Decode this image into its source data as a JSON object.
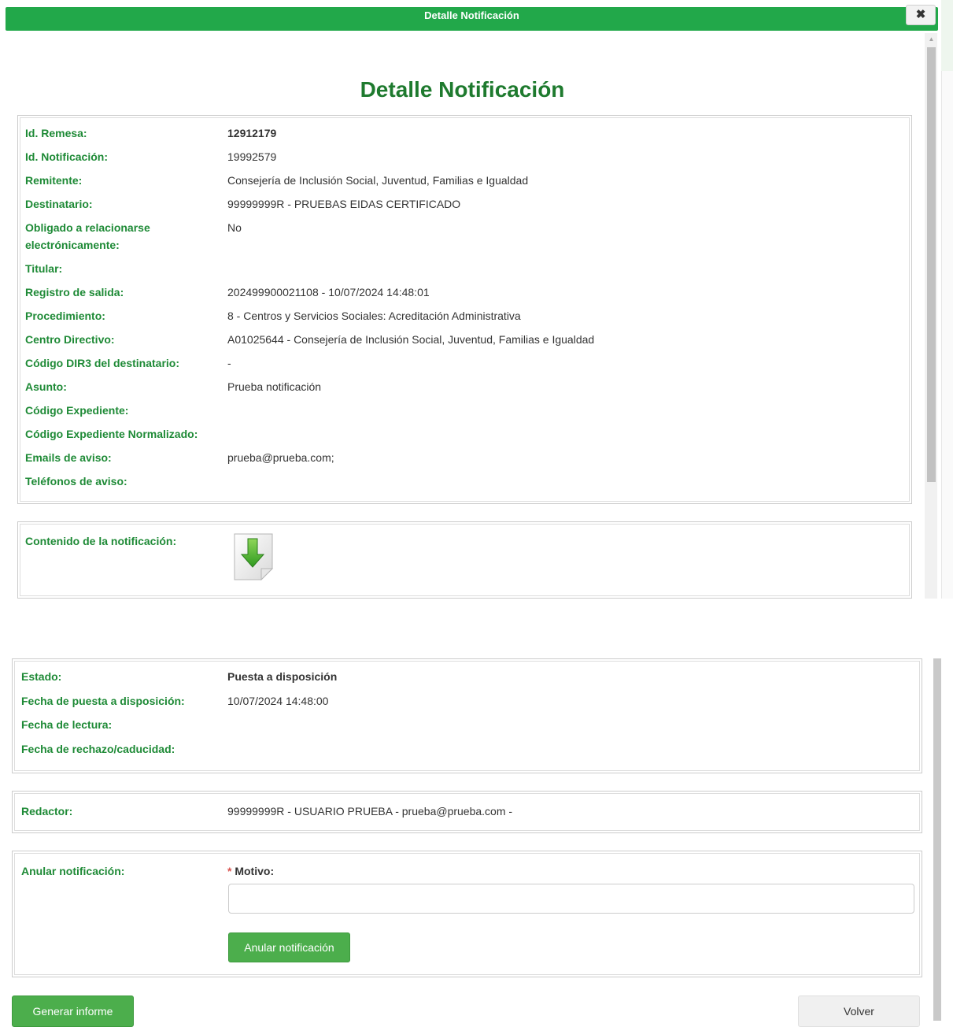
{
  "modal": {
    "title": "Detalle Notificación",
    "close_icon": "✖"
  },
  "heading": "Detalle Notificación",
  "details": {
    "id_remesa_label": "Id. Remesa:",
    "id_remesa_value": "12912179",
    "id_notificacion_label": "Id. Notificación:",
    "id_notificacion_value": "19992579",
    "remitente_label": "Remitente:",
    "remitente_value": "Consejería de Inclusión Social, Juventud, Familias e Igualdad",
    "destinatario_label": "Destinatario:",
    "destinatario_value": "99999999R - PRUEBAS EIDAS CERTIFICADO",
    "obligado_label_1": "Obligado a relacionarse",
    "obligado_label_2": "electrónicamente:",
    "obligado_value": "No",
    "titular_label": "Titular:",
    "registro_label": "Registro de salida:",
    "registro_value": "202499900021108 - 10/07/2024 14:48:01",
    "procedimiento_label": "Procedimiento:",
    "procedimiento_value": "8 - Centros y Servicios Sociales: Acreditación Administrativa",
    "centro_label": "Centro Directivo:",
    "centro_value": "A01025644 - Consejería de Inclusión Social, Juventud, Familias e Igualdad",
    "dir3_label": "Código DIR3 del destinatario:",
    "dir3_value": "-",
    "asunto_label": "Asunto:",
    "asunto_value": "Prueba notificación",
    "expediente_label": "Código Expediente:",
    "expediente_norm_label": "Código Expediente Normalizado:",
    "emails_label": "Emails de aviso:",
    "emails_value": "prueba@prueba.com;",
    "telefonos_label": "Teléfonos de aviso:"
  },
  "contenido": {
    "label": "Contenido de la notificación:",
    "icon": "download-document-icon"
  },
  "estado": {
    "estado_label": "Estado:",
    "estado_value": "Puesta a disposición",
    "fecha_disposicion_label": "Fecha de puesta a disposición:",
    "fecha_disposicion_value": "10/07/2024 14:48:00",
    "fecha_lectura_label": "Fecha de lectura:",
    "fecha_rechazo_label": "Fecha de rechazo/caducidad:"
  },
  "redactor": {
    "label": "Redactor:",
    "value": "99999999R - USUARIO PRUEBA - prueba@prueba.com -"
  },
  "anular": {
    "label": "Anular notificación:",
    "required_mark": "*",
    "motivo_label": "Motivo:",
    "motivo_value": "",
    "button_label": "Anular notificación"
  },
  "footer": {
    "generar_label": "Generar informe",
    "volver_label": "Volver"
  },
  "colors": {
    "brand_green": "#22a84a",
    "label_green": "#1e8a36",
    "heading_green": "#1e7a2e",
    "button_green": "#4cae4c"
  }
}
